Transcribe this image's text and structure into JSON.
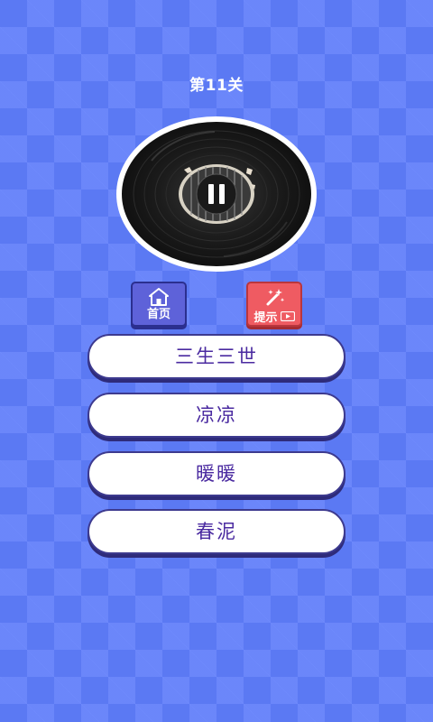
{
  "level": {
    "title": "第11关"
  },
  "player": {
    "state": "playing",
    "icon": "pause-icon"
  },
  "buttons": {
    "home": {
      "label": "首页",
      "icon": "home-icon",
      "color": "#5e62d9"
    },
    "hint": {
      "label": "提示",
      "icon": "magic-wand-icon",
      "badge_icon": "video-icon",
      "color": "#ef5b62"
    }
  },
  "answers": [
    {
      "label": "三生三世"
    },
    {
      "label": "凉凉"
    },
    {
      "label": "暖暖"
    },
    {
      "label": "春泥"
    }
  ],
  "colors": {
    "background": "#5b79f3",
    "answer_text": "#4a2aa0",
    "answer_border": "#3d3a8f"
  }
}
